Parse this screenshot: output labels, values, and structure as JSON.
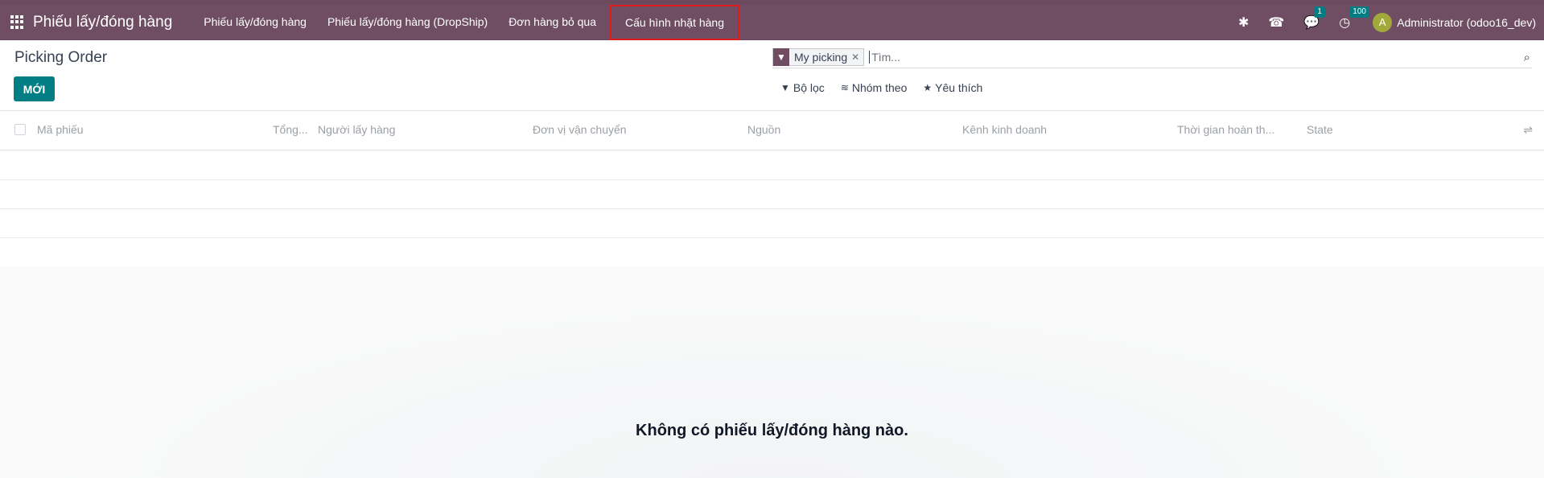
{
  "navbar": {
    "brand": "Phiếu lấy/đóng hàng",
    "menu": [
      "Phiếu lấy/đóng hàng",
      "Phiếu lấy/đóng hàng (DropShip)",
      "Đơn hàng bỏ qua",
      "Cấu hình nhặt hàng"
    ],
    "highlighted_item": "Cấu hình nhặt hàng",
    "messages_badge": "1",
    "activities_badge": "100",
    "avatar_letter": "A",
    "user": "Administrator (odoo16_dev)"
  },
  "control": {
    "title": "Picking Order",
    "new_button": "MỚI"
  },
  "search": {
    "facet": "My picking",
    "placeholder": "Tìm...",
    "filters": "Bộ lọc",
    "group_by": "Nhóm theo",
    "favorites": "Yêu thích"
  },
  "list": {
    "columns": [
      "Mã phiếu",
      "Tổng...",
      "Người lấy hàng",
      "Đơn vị vận chuyển",
      "Nguồn",
      "Kênh kinh doanh",
      "Thời gian hoàn th...",
      "State"
    ]
  },
  "empty_message": "Không có phiếu lấy/đóng hàng nào.",
  "colors": {
    "navbar": "#6f4e63",
    "primary": "#017e84",
    "highlight_outline": "#e01b1b"
  }
}
